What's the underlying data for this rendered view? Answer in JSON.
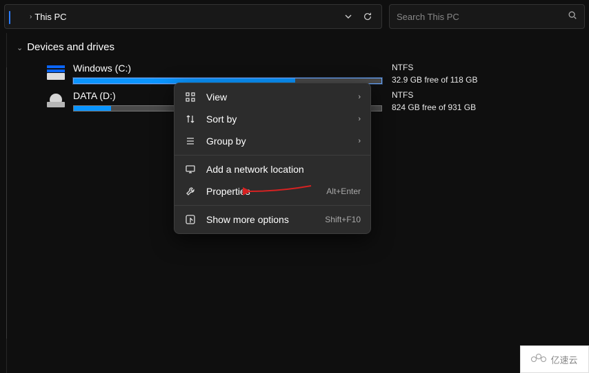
{
  "addressbar": {
    "location": "This PC"
  },
  "search": {
    "placeholder": "Search This PC"
  },
  "section": {
    "title": "Devices and drives"
  },
  "drives": [
    {
      "name": "Windows (C:)",
      "fs": "NTFS",
      "free": "32.9 GB free of 118 GB",
      "used_pct": 72,
      "selected": true,
      "icon": "hdd"
    },
    {
      "name": "DATA (D:)",
      "fs": "NTFS",
      "free": "824 GB free of 931 GB",
      "used_pct": 12,
      "selected": false,
      "icon": "dvd"
    }
  ],
  "context_menu": {
    "items": [
      {
        "icon": "grid",
        "label": "View",
        "submenu": true
      },
      {
        "icon": "sort",
        "label": "Sort by",
        "submenu": true
      },
      {
        "icon": "group",
        "label": "Group by",
        "submenu": true
      },
      {
        "sep": true
      },
      {
        "icon": "monitor",
        "label": "Add a network location"
      },
      {
        "icon": "wrench",
        "label": "Properties",
        "shortcut": "Alt+Enter"
      },
      {
        "sep": true
      },
      {
        "icon": "more",
        "label": "Show more options",
        "shortcut": "Shift+F10"
      }
    ]
  },
  "watermark": {
    "text": "亿速云"
  }
}
